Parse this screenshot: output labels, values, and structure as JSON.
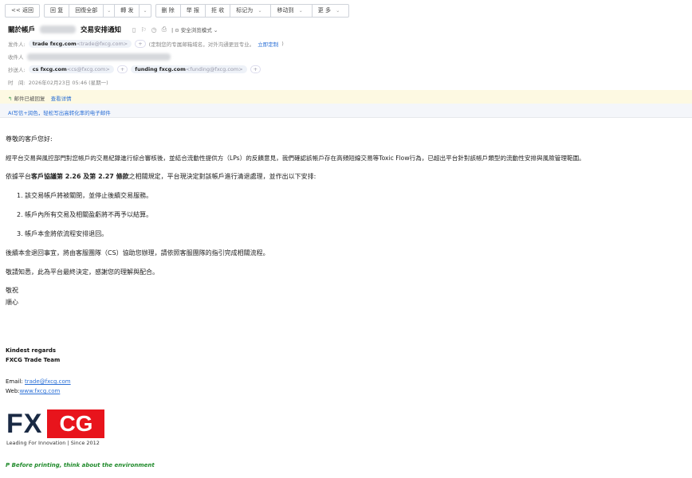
{
  "toolbar": {
    "back": "<< 返回",
    "reply": "回 复",
    "reply_all": "回復全部",
    "forward": "轉 发",
    "delete": "删 除",
    "report": "举 报",
    "reject": "拒 收",
    "mark_as": "标记为",
    "move_to": "移动到",
    "more": "更 多"
  },
  "header": {
    "subject_prefix": "關於帳戶",
    "subject_suffix": "交易安排通知",
    "safe_mode": "安全浏览模式",
    "sender_label": "发件人:",
    "sender_name": "trade fxcg.com",
    "sender_email": "<trade@fxcg.com>",
    "sender_note": "(定制您的专属邮箱域名，对外沟通更显专业。",
    "customize_link": "立即定制",
    "recipient_label": "收件人",
    "cc_label": "抄送人:",
    "cc": [
      {
        "name": "cs fxcg.com",
        "email": "<cs@fxcg.com>"
      },
      {
        "name": "funding fxcg.com",
        "email": "<funding@fxcg.com>"
      }
    ],
    "time_label": "时　间:",
    "time": "2026年02月23日 05:46 (星期一)"
  },
  "notice": {
    "text": "邮件已被回复",
    "link": "查看详情"
  },
  "ai_banner": "AI写信+润色，轻松写出高转化率的电子邮件",
  "body": {
    "greeting": "尊敬的客戶您好:",
    "p1": "經平台交易與風控部門對您帳戶的交易紀錄進行綜合審核後，並結合流動性提供方（LPs）的反饋意見，我們確認該帳戶存在高頻短線交易等Toxic Flow行為，已超出平台針對該帳戶類型的流動性安排與風險管理範圍。",
    "p2_a": "依據平台",
    "p2_b": "客戶協議第 2.26 及第 2.27 條款",
    "p2_c": "之相關規定，平台現決定對該帳戶進行清退處理，並作出以下安排:",
    "list": [
      "1. 該交易帳戶將被關閉，並停止後續交易服務。",
      "2. 帳戶內所有交易及相關盈虧將不再予以結算。",
      "3. 帳戶本金將依流程安排退回。"
    ],
    "p3": "後續本金退回事宜，將由客服團隊（CS）協助您辦理，請依照客服團隊的指引完成相關流程。",
    "p4": "敬請知悉，此為平台最終決定，感謝您的理解與配合。",
    "closing1": "敬祝",
    "closing2": "順心"
  },
  "signature": {
    "regards": "Kindest regards",
    "team": "FXCG Trade Team",
    "email_label": "Email:",
    "email": "trade@fxcg.com",
    "web_label": "Web:",
    "web": "www.fxcg.com",
    "logo_fx": "FX",
    "logo_cg": "CG",
    "tagline": "Leading For Innovation | Since 2012",
    "eco": "P Before printing, think about the environment"
  }
}
